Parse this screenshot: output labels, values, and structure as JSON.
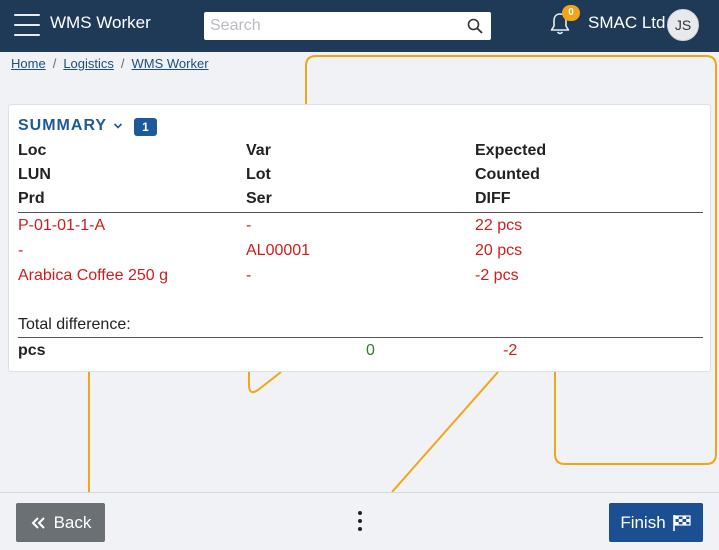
{
  "header": {
    "app_title": "WMS Worker",
    "search_placeholder": "Search",
    "notification_count": "0",
    "company": "SMAC Ltd",
    "user_initials": "JS"
  },
  "breadcrumb": {
    "items": [
      "Home",
      "Logistics",
      "WMS Worker"
    ],
    "separator": "/"
  },
  "summary": {
    "title": "SUMMARY",
    "count": "1",
    "column_headers": {
      "col1": [
        "Loc",
        "LUN",
        "Prd"
      ],
      "col2": [
        "Var",
        "Lot",
        "Ser"
      ],
      "col3": [
        "Expected",
        "Counted",
        "DIFF"
      ]
    },
    "row": {
      "loc": "P-01-01-1-A",
      "lun": "-",
      "prd": "Arabica Coffee 250 g",
      "var": "-",
      "lot": "AL00001",
      "ser": "-",
      "expected": "22 pcs",
      "counted": "20 pcs",
      "diff": "-2 pcs"
    },
    "total": {
      "label": "Total difference:",
      "unit": "pcs",
      "positive": "0",
      "negative": "-2"
    }
  },
  "footer": {
    "back_label": "Back",
    "finish_label": "Finish"
  },
  "colors": {
    "header_bg": "#1f3a57",
    "accent_blue": "#1c5a99",
    "diff_red": "#d11c1c",
    "positive_green": "#2f7d32",
    "badge_orange": "#f2a516",
    "decoration_orange": "#f2a516",
    "finish_blue": "#1b4f91",
    "back_grey": "#6b7075"
  }
}
